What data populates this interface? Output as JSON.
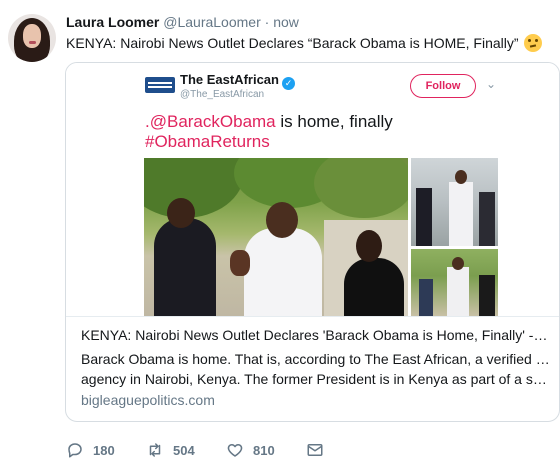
{
  "tweet": {
    "author_name": "Laura Loomer",
    "author_handle": "@LauraLoomer",
    "separator": "·",
    "time": "now",
    "text": "KENYA: Nairobi News Outlet Declares “Barack Obama is HOME, Finally”",
    "emoji": "thinking-face"
  },
  "card": {
    "image": {
      "account_name": "The EastAfrican",
      "account_handle": "@The_EastAfrican",
      "follow_label": "Follow",
      "headline_mention": ".@BarackObama",
      "headline_rest": " is home, finally",
      "headline_hashtag": "#ObamaReturns"
    },
    "title": "KENYA: Nairobi News Outlet Declares 'Barack Obama is Home, Finally' - Big…",
    "description_lines": [
      "Barack Obama is home. That is, according to The East African, a verified news",
      "agency in Nairobi, Kenya. The former President is in Kenya as part of a schedu…"
    ],
    "domain": "bigleaguepolitics.com"
  },
  "actions": {
    "reply_count": "180",
    "retweet_count": "504",
    "like_count": "810"
  },
  "colors": {
    "accent_red": "#e0245e",
    "verified_blue": "#1da1f2",
    "muted_text": "#657786"
  }
}
